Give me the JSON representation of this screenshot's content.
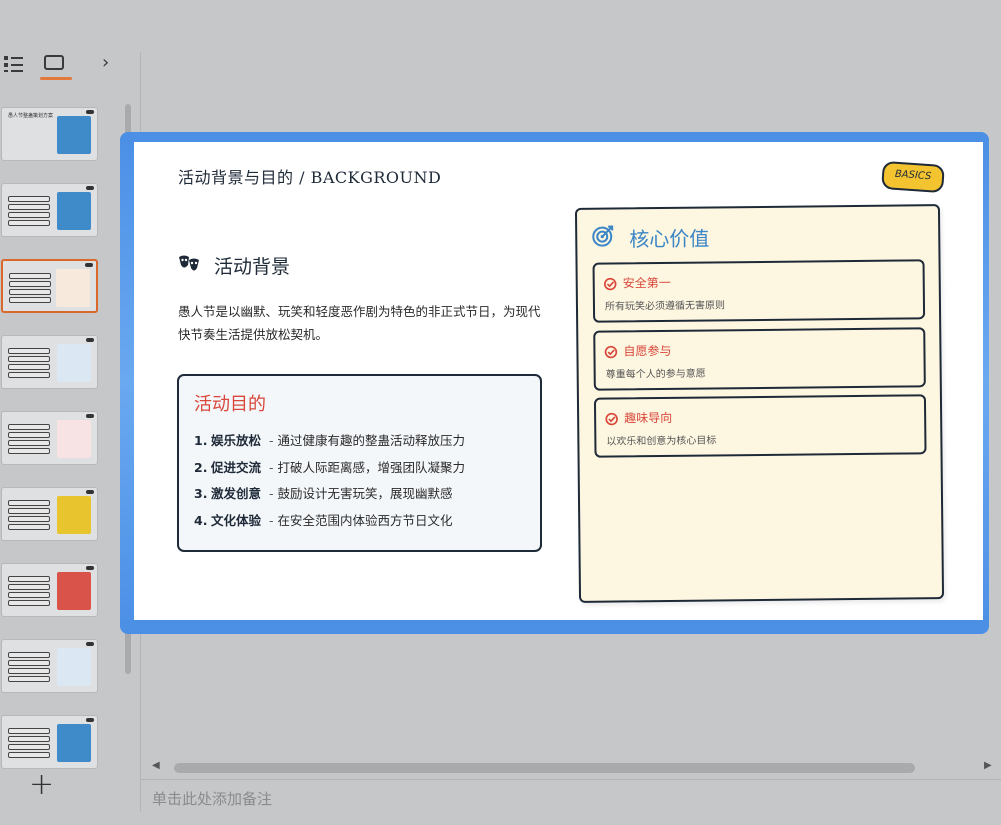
{
  "toolbar": {
    "list_view_icon": "list-icon",
    "slide_view_icon": "slide-icon",
    "expand_icon": "chevron-right-icon",
    "expand_glyph": "›",
    "add_slide_glyph": "+"
  },
  "colors": {
    "app_bg": "#c6c7c9",
    "active_thumb_border": "#d9682c",
    "slide_frame": "#4b8fe6",
    "accent_red": "#d8473a",
    "accent_blue": "#3b86c6",
    "badge_yellow": "#f4c430",
    "panel_cream": "#fdf6e1"
  },
  "thumbnails": [
    {
      "index": 1,
      "card_color": "#3f8ac9",
      "title": "愚人节整蛊策划方案",
      "active": false
    },
    {
      "index": 2,
      "card_color": "#3f8ac9",
      "active": false
    },
    {
      "index": 3,
      "card_color": "#f7e9dc",
      "active": true
    },
    {
      "index": 4,
      "card_color": "#dbe7f3",
      "active": false
    },
    {
      "index": 5,
      "card_color": "#f7e3e3",
      "active": false
    },
    {
      "index": 6,
      "card_color": "#e8c52f",
      "active": false
    },
    {
      "index": 7,
      "card_color": "#d9534a",
      "active": false
    },
    {
      "index": 8,
      "card_color": "#dbe7f3",
      "active": false
    },
    {
      "index": 9,
      "card_color": "#3f8ac9",
      "active": false
    }
  ],
  "slide": {
    "header": "活动背景与目的 / BACKGROUND",
    "badge": "BASICS",
    "background_title": "活动背景",
    "background_icon": "theater-masks-icon",
    "background_desc": "愚人节是以幽默、玩笑和轻度恶作剧为特色的非正式节日，为现代快节奏生活提供放松契机。",
    "purpose": {
      "title": "活动目的",
      "items": [
        {
          "num": "1.",
          "key": "娱乐放松",
          "desc": "通过健康有趣的整蛊活动释放压力"
        },
        {
          "num": "2.",
          "key": "促进交流",
          "desc": "打破人际距离感，增强团队凝聚力"
        },
        {
          "num": "3.",
          "key": "激发创意",
          "desc": "鼓励设计无害玩笑，展现幽默感"
        },
        {
          "num": "4.",
          "key": "文化体验",
          "desc": "在安全范围内体验西方节日文化"
        }
      ]
    },
    "core": {
      "title": "核心价值",
      "icon": "target-icon",
      "cards": [
        {
          "title": "安全第一",
          "desc": "所有玩笑必须遵循无害原则",
          "icon": "check-circle-icon"
        },
        {
          "title": "自愿参与",
          "desc": "尊重每个人的参与意愿",
          "icon": "check-circle-icon"
        },
        {
          "title": "趣味导向",
          "desc": "以欢乐和创意为核心目标",
          "icon": "check-circle-icon"
        }
      ]
    }
  },
  "notes_placeholder": "单击此处添加备注",
  "scroll": {
    "left_arrow": "◀",
    "right_arrow": "▶"
  }
}
